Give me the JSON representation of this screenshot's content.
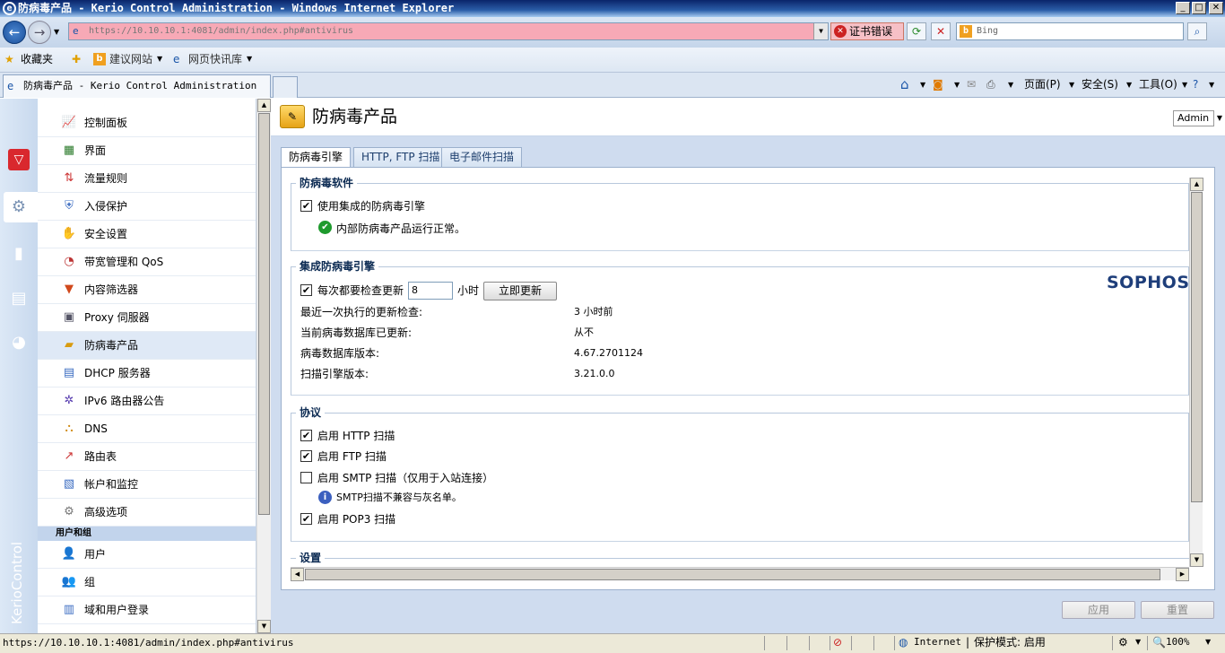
{
  "window": {
    "title": "防病毒产品 - Kerio Control Administration - Windows Internet Explorer",
    "min_label": "_",
    "max_label": "□",
    "close_label": "✕"
  },
  "nav": {
    "url": "https://10.10.10.1:4081/admin/index.php#antivirus",
    "cert_error": "证书错误",
    "search_placeholder": "Bing"
  },
  "favorites": {
    "favorites_label": "收藏夹",
    "suggested_sites": "建议网站",
    "web_slice": "网页快讯库"
  },
  "tab": {
    "title": "防病毒产品 - Kerio Control Administration"
  },
  "commandbar": {
    "page": "页面(P)",
    "safety": "安全(S)",
    "tools": "工具(O)"
  },
  "rail": {
    "brand": "KerioControl"
  },
  "menu": {
    "items": [
      {
        "label": "控制面板",
        "icon": "dashboard-icon"
      },
      {
        "label": "界面",
        "icon": "interface-icon"
      },
      {
        "label": "流量规则",
        "icon": "traffic-rules-icon"
      },
      {
        "label": "入侵保护",
        "icon": "shield-icon"
      },
      {
        "label": "安全设置",
        "icon": "hand-stop-icon"
      },
      {
        "label": "带宽管理和 QoS",
        "icon": "bandwidth-icon"
      },
      {
        "label": "内容筛选器",
        "icon": "funnel-icon"
      },
      {
        "label": "Proxy 伺服器",
        "icon": "proxy-icon"
      },
      {
        "label": "防病毒产品",
        "icon": "antivirus-folder-icon"
      },
      {
        "label": "DHCP 服务器",
        "icon": "dhcp-icon"
      },
      {
        "label": "IPv6 路由器公告",
        "icon": "ipv6-icon"
      },
      {
        "label": "DNS",
        "icon": "dns-icon"
      },
      {
        "label": "路由表",
        "icon": "routing-icon"
      },
      {
        "label": "帐户和监控",
        "icon": "accounting-icon"
      },
      {
        "label": "高级选项",
        "icon": "gears-icon"
      }
    ],
    "users_heading": "用户和组",
    "user_items": [
      {
        "label": "用户",
        "icon": "user-icon"
      },
      {
        "label": "组",
        "icon": "group-icon"
      },
      {
        "label": "域和用户登录",
        "icon": "domain-icon"
      }
    ]
  },
  "header": {
    "title": "防病毒产品",
    "admin": "Admin"
  },
  "tabs": [
    {
      "label": "防病毒引擎"
    },
    {
      "label": "HTTP, FTP 扫描"
    },
    {
      "label": "电子邮件扫描"
    }
  ],
  "av_software": {
    "legend": "防病毒软件",
    "use_integrated": "使用集成的防病毒引擎",
    "status": "内部防病毒产品运行正常。"
  },
  "engine": {
    "legend": "集成防病毒引擎",
    "check_every": "每次都要检查更新",
    "hours_value": "8",
    "hours_unit": "小时",
    "update_now": "立即更新",
    "vendor": "SOPHOS",
    "rows": [
      {
        "label": "最近一次执行的更新检查:",
        "value": "3 小时前"
      },
      {
        "label": "当前病毒数据库已更新:",
        "value": "从不"
      },
      {
        "label": "病毒数据库版本:",
        "value": "4.67.2701124"
      },
      {
        "label": "扫描引擎版本:",
        "value": "3.21.0.0"
      }
    ]
  },
  "protocols": {
    "legend": "协议",
    "http": "启用 HTTP 扫描",
    "ftp": "启用 FTP 扫描",
    "smtp": "启用 SMTP 扫描（仅用于入站连接）",
    "smtp_note": "SMTP扫描不兼容与灰名单。",
    "pop3": "启用 POP3 扫描",
    "http_checked": true,
    "ftp_checked": true,
    "smtp_checked": false,
    "pop3_checked": true
  },
  "settings": {
    "legend": "设置"
  },
  "footer": {
    "apply": "应用",
    "reset": "重置"
  },
  "statusbar": {
    "url": "https://10.10.10.1:4081/admin/index.php#antivirus",
    "zone": "Internet",
    "protected_mode": "保护模式: 启用",
    "zoom": "100%"
  }
}
